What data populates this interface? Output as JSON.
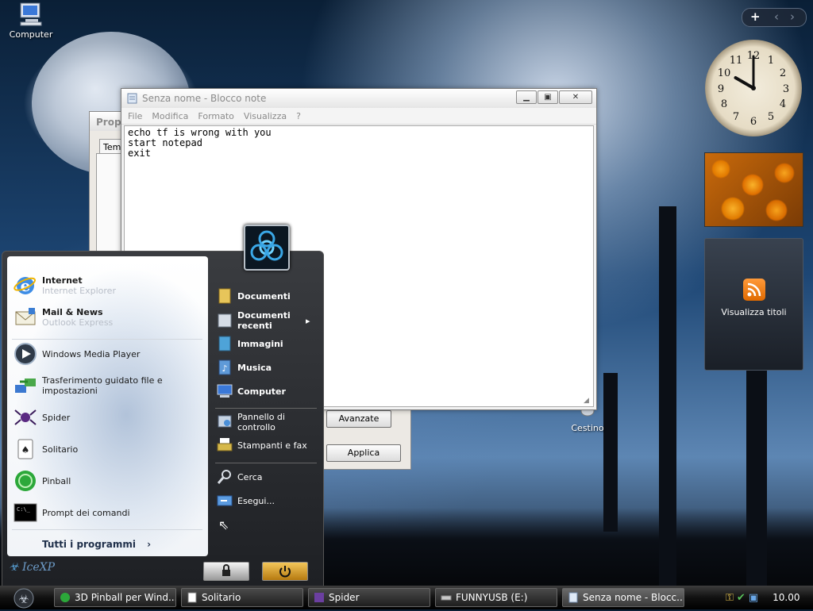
{
  "desktop": {
    "computer_label": "Computer",
    "recycle_label": "Cestino"
  },
  "sidebar": {
    "add_glyph": "+",
    "prev_glyph": "‹",
    "next_glyph": "›",
    "feeds_label": "Visualizza titoli",
    "clock_hour": 10,
    "clock_minute": 0
  },
  "props_window": {
    "title": "Propr",
    "tab": "Tem",
    "advanced_button": "Avanzate",
    "apply_button": "Applica"
  },
  "notepad": {
    "title": "Senza nome - Blocco note",
    "menu": [
      "File",
      "Modifica",
      "Formato",
      "Visualizza",
      "?"
    ],
    "content": "echo tf is wrong with you\nstart notepad\nexit"
  },
  "start_menu": {
    "pinned": [
      {
        "label": "Internet",
        "sub": "Internet Explorer",
        "icon": "ie-icon"
      },
      {
        "label": "Mail & News",
        "sub": "Outlook Express",
        "icon": "mail-icon"
      }
    ],
    "recent": [
      {
        "label": "Windows Media Player",
        "icon": "media-player-icon"
      },
      {
        "label": "Trasferimento guidato file e impostazioni",
        "icon": "transfer-wizard-icon"
      },
      {
        "label": "Spider",
        "icon": "spider-icon"
      },
      {
        "label": "Solitario",
        "icon": "solitaire-icon"
      },
      {
        "label": "Pinball",
        "icon": "pinball-icon"
      },
      {
        "label": "Prompt dei comandi",
        "icon": "cmd-icon"
      }
    ],
    "all_programs": "Tutti i programmi",
    "places": [
      {
        "label": "Documenti",
        "icon": "documents-icon"
      },
      {
        "label": "Documenti recenti",
        "icon": "recent-documents-icon"
      },
      {
        "label": "Immagini",
        "icon": "pictures-icon"
      },
      {
        "label": "Musica",
        "icon": "music-icon"
      },
      {
        "label": "Computer",
        "icon": "computer-icon"
      }
    ],
    "system": [
      {
        "label": "Pannello di controllo",
        "icon": "control-panel-icon"
      },
      {
        "label": "Stampanti e fax",
        "icon": "printers-icon"
      }
    ],
    "tools": [
      {
        "label": "Cerca",
        "icon": "search-icon"
      },
      {
        "label": "Esegui...",
        "icon": "run-icon"
      }
    ],
    "brand": "IceXP"
  },
  "taskbar": {
    "buttons": [
      {
        "label": "3D Pinball per Wind...",
        "icon": "pinball-icon"
      },
      {
        "label": "Solitario",
        "icon": "solitaire-icon"
      },
      {
        "label": "Spider",
        "icon": "spider-icon"
      },
      {
        "label": "FUNNYUSB (E:)",
        "icon": "usb-drive-icon"
      },
      {
        "label": "Senza nome - Blocc...",
        "icon": "notepad-icon"
      }
    ],
    "time": "10.00"
  }
}
